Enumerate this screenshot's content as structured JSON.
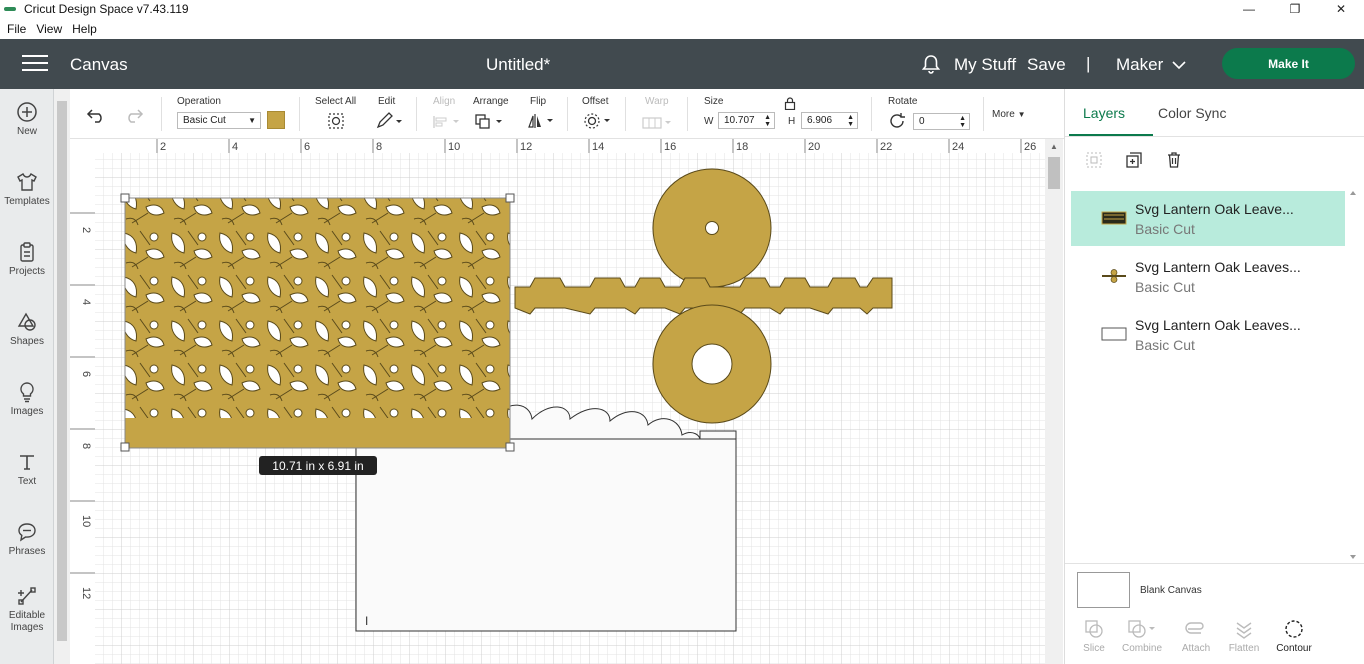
{
  "window": {
    "title": "Cricut Design Space  v7.43.119",
    "minimize": "—",
    "maximize": "❐",
    "close": "✕"
  },
  "menu": [
    "File",
    "View",
    "Help"
  ],
  "header": {
    "section": "Canvas",
    "document": "Untitled*",
    "my_stuff": "My Stuff",
    "save": "Save",
    "separator": "|",
    "machine": "Maker",
    "make_it": "Make It"
  },
  "sidebar": {
    "items": [
      {
        "label": "New",
        "icon": "plus-circle-icon"
      },
      {
        "label": "Templates",
        "icon": "shirt-icon"
      },
      {
        "label": "Projects",
        "icon": "clipboard-icon"
      },
      {
        "label": "Shapes",
        "icon": "shapes-icon"
      },
      {
        "label": "Images",
        "icon": "lightbulb-icon"
      },
      {
        "label": "Text",
        "icon": "text-icon"
      },
      {
        "label": "Phrases",
        "icon": "speech-bubble-icon"
      },
      {
        "label": "Editable",
        "label2": "Images",
        "icon": "editable-images-icon"
      }
    ]
  },
  "toolbar": {
    "operation_label": "Operation",
    "operation_value": "Basic Cut",
    "operation_color": "#c5a446",
    "select_all": "Select All",
    "edit": "Edit",
    "align": "Align",
    "arrange": "Arrange",
    "flip": "Flip",
    "offset": "Offset",
    "warp": "Warp",
    "size_label": "Size",
    "w_label": "W",
    "w_value": "10.707",
    "h_label": "H",
    "h_value": "6.906",
    "rotate_label": "Rotate",
    "rotate_value": "0",
    "more": "More"
  },
  "canvas": {
    "ruler_x": [
      "2",
      "4",
      "6",
      "8",
      "10",
      "12",
      "14",
      "16",
      "18",
      "20",
      "22",
      "24",
      "26"
    ],
    "ruler_y": [
      "2",
      "4",
      "6",
      "8",
      "10",
      "12"
    ],
    "dimension_tooltip": "10.71  in x 6.91  in",
    "design_color": "#c5a446",
    "text_cursor": "I"
  },
  "layers_panel": {
    "tabs": [
      "Layers",
      "Color Sync"
    ],
    "layers": [
      {
        "name": "Svg Lantern Oak Leave...",
        "operation": "Basic Cut",
        "selected": true
      },
      {
        "name": "Svg Lantern Oak Leaves...",
        "operation": "Basic Cut",
        "selected": false
      },
      {
        "name": "Svg Lantern Oak Leaves...",
        "operation": "Basic Cut",
        "selected": false
      }
    ],
    "blank_canvas": "Blank Canvas",
    "actions": [
      {
        "label": "Slice",
        "enabled": false
      },
      {
        "label": "Combine",
        "enabled": false
      },
      {
        "label": "Attach",
        "enabled": false
      },
      {
        "label": "Flatten",
        "enabled": false
      },
      {
        "label": "Contour",
        "enabled": true
      }
    ]
  }
}
